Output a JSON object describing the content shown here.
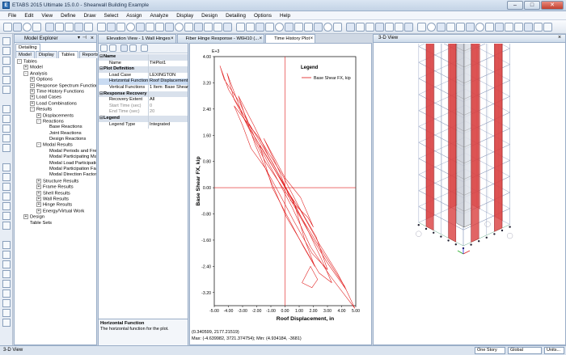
{
  "window": {
    "title": "ETABS 2015 Ultimate 15.0.0 - Shearwall Building Example",
    "icon_letter": "E",
    "minimize": "–",
    "maximize": "□",
    "close": "✕"
  },
  "menu": [
    "File",
    "Edit",
    "View",
    "Define",
    "Draw",
    "Select",
    "Assign",
    "Analyze",
    "Display",
    "Design",
    "Detailing",
    "Options",
    "Help"
  ],
  "explorer": {
    "title": "Model Explorer",
    "tabs": [
      "Detailing"
    ],
    "tabs2": [
      "Model",
      "Display",
      "Tables",
      "Reports"
    ],
    "active_tab": "Tables",
    "tree": [
      {
        "label": "Tables",
        "depth": 0,
        "exp": "-"
      },
      {
        "label": "Model",
        "depth": 1,
        "exp": "+"
      },
      {
        "label": "Analysis",
        "depth": 1,
        "exp": "-"
      },
      {
        "label": "Options",
        "depth": 2,
        "exp": "+"
      },
      {
        "label": "Response Spectrum Functions",
        "depth": 2,
        "exp": "+"
      },
      {
        "label": "Time History Functions",
        "depth": 2,
        "exp": "+"
      },
      {
        "label": "Load Cases",
        "depth": 2,
        "exp": "+"
      },
      {
        "label": "Load Combinations",
        "depth": 2,
        "exp": "+"
      },
      {
        "label": "Results",
        "depth": 2,
        "exp": "-"
      },
      {
        "label": "Displacements",
        "depth": 3,
        "exp": "+"
      },
      {
        "label": "Reactions",
        "depth": 3,
        "exp": "-"
      },
      {
        "label": "Base Reactions",
        "depth": 4,
        "exp": ""
      },
      {
        "label": "Joint Reactions",
        "depth": 4,
        "exp": ""
      },
      {
        "label": "Design Reactions",
        "depth": 4,
        "exp": ""
      },
      {
        "label": "Modal Results",
        "depth": 3,
        "exp": "-"
      },
      {
        "label": "Modal Periods and Frec",
        "depth": 4,
        "exp": ""
      },
      {
        "label": "Modal Participating Mas",
        "depth": 4,
        "exp": ""
      },
      {
        "label": "Modal Load Participatio",
        "depth": 4,
        "exp": ""
      },
      {
        "label": "Modal Participation Fac",
        "depth": 4,
        "exp": ""
      },
      {
        "label": "Modal Direction Factors",
        "depth": 4,
        "exp": ""
      },
      {
        "label": "Structure Results",
        "depth": 3,
        "exp": "+"
      },
      {
        "label": "Frame Results",
        "depth": 3,
        "exp": "+"
      },
      {
        "label": "Shell Results",
        "depth": 3,
        "exp": "+"
      },
      {
        "label": "Wall Results",
        "depth": 3,
        "exp": "+"
      },
      {
        "label": "Hinge Results",
        "depth": 3,
        "exp": "+"
      },
      {
        "label": "Energy/Virtual Work",
        "depth": 3,
        "exp": "+"
      },
      {
        "label": "Design",
        "depth": 1,
        "exp": "+"
      },
      {
        "label": "Table Sets",
        "depth": 1,
        "exp": ""
      }
    ]
  },
  "doc_tabs": [
    "Elevation View - 1  Wall Hinges",
    "Fiber Hinge Response - W6H10 (...",
    "Time History Plot"
  ],
  "view3d_tab": "3-D View",
  "props": {
    "rows": [
      {
        "type": "cat",
        "k": "Name",
        "v": ""
      },
      {
        "type": "row",
        "k": "Name",
        "v": "THPlot1"
      },
      {
        "type": "cat",
        "k": "Plot Definition",
        "v": ""
      },
      {
        "type": "row",
        "k": "Load Case",
        "v": "LEXINGTON"
      },
      {
        "type": "sel",
        "k": "Horizontal Function",
        "v": "Roof Displacement"
      },
      {
        "type": "row",
        "k": "Vertical Functions",
        "v": "1 Item: Base Shear FX,"
      },
      {
        "type": "cat",
        "k": "Response Recovery",
        "v": ""
      },
      {
        "type": "row",
        "k": "Recovery Extent",
        "v": "All"
      },
      {
        "type": "dim",
        "k": "Start Time (sec)",
        "v": "0"
      },
      {
        "type": "dim",
        "k": "End Time (sec)",
        "v": "20"
      },
      {
        "type": "cat",
        "k": "Legend",
        "v": ""
      },
      {
        "type": "row",
        "k": "Legend Type",
        "v": "Integrated"
      }
    ],
    "help_title": "Horizontal Function",
    "help_text": "The horizontal function for the plot."
  },
  "chart_data": {
    "type": "line",
    "xlabel": "Roof Displacement,  in",
    "ylabel": "Base Shear FX,  kip",
    "yexp": "E+3",
    "xlim": [
      -5.0,
      5.0
    ],
    "ylim": [
      -3.6,
      4.0
    ],
    "xticks": [
      "-5.00",
      "-4.00",
      "-3.00",
      "-2.00",
      "-1.00",
      "0.00",
      "1.00",
      "2.00",
      "3.00",
      "4.00",
      "5.00"
    ],
    "yticks": [
      "4.00",
      "3.20",
      "2.40",
      "1.60",
      "0.80",
      "0.00",
      "-0.80",
      "-1.60",
      "-2.40",
      "-3.20"
    ],
    "legend_title": "Legend",
    "series": [
      {
        "name": "Base Shear FX, kip",
        "color": "#e01818"
      }
    ],
    "readout": "(0.340599, 2177.21519)",
    "maxmin": "Max: (-4.639982, 3721.374754);   Min: (4.934184, -3681)"
  },
  "status": {
    "left": "3-D View",
    "story": "One Story",
    "coord": "Global",
    "units": "Units..."
  }
}
